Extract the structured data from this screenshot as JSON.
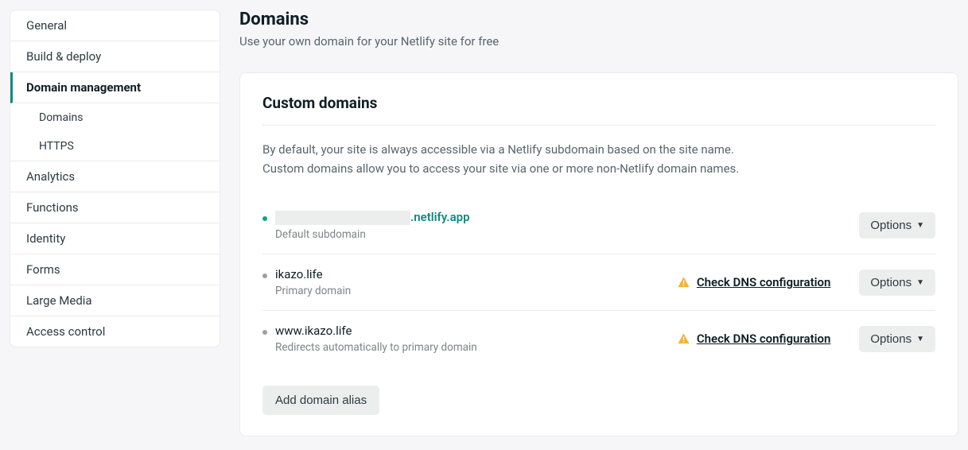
{
  "sidebar": {
    "items": [
      {
        "label": "General"
      },
      {
        "label": "Build & deploy"
      },
      {
        "label": "Domain management",
        "active": true
      },
      {
        "label": "Analytics"
      },
      {
        "label": "Functions"
      },
      {
        "label": "Identity"
      },
      {
        "label": "Forms"
      },
      {
        "label": "Large Media"
      },
      {
        "label": "Access control"
      }
    ],
    "subitems": [
      {
        "label": "Domains"
      },
      {
        "label": "HTTPS"
      }
    ]
  },
  "page": {
    "title": "Domains",
    "subtitle": "Use your own domain for your Netlify site for free"
  },
  "card": {
    "title": "Custom domains",
    "desc1": "By default, your site is always accessible via a Netlify subdomain based on the site name.",
    "desc2": "Custom domains allow you to access your site via one or more non-Netlify domain names.",
    "addButton": "Add domain alias",
    "optionsLabel": "Options"
  },
  "domains": [
    {
      "suffix": ".netlify.app",
      "sub": "Default subdomain",
      "redacted": true,
      "bullet": "teal",
      "link": true,
      "warn": false
    },
    {
      "name": "ikazo.life",
      "sub": "Primary domain",
      "bullet": "gray",
      "warn": true,
      "warnText": "Check DNS configuration"
    },
    {
      "name": "www.ikazo.life",
      "sub": "Redirects automatically to primary domain",
      "bullet": "gray",
      "warn": true,
      "warnText": "Check DNS configuration"
    }
  ]
}
